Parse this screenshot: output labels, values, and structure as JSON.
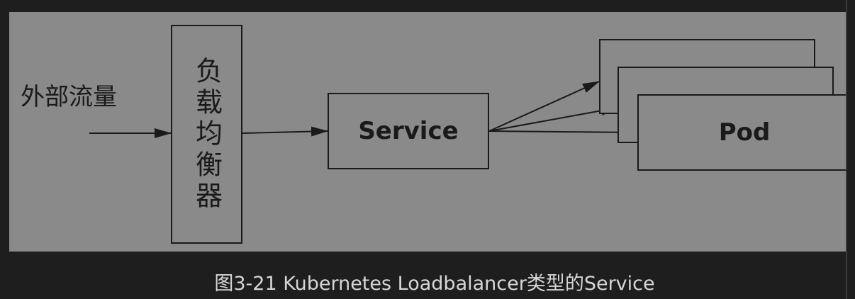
{
  "diagram": {
    "external_traffic_label": "外部流量",
    "load_balancer_label": "负载均衡器",
    "service_label": "Service",
    "pod_label": "Pod"
  },
  "caption": "图3-21 Kubernetes Loadbalancer类型的Service",
  "colors": {
    "page_background": "#1e1e1e",
    "figure_background": "#8a8a8a",
    "stroke": "#1a1a1a",
    "caption_text": "#d6d6d6"
  }
}
